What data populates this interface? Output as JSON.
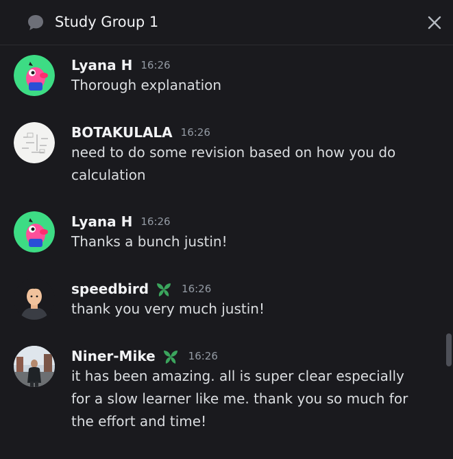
{
  "header": {
    "title": "Study Group 1",
    "thread_icon": "thread-bubble-icon",
    "close_icon": "close-icon"
  },
  "messages": [
    {
      "username": "Lyana H",
      "badge": "",
      "time": "16:26",
      "text": "Thorough explanation",
      "avatar": "pink-bird-avatar"
    },
    {
      "username": "BOTAKULALA",
      "badge": "",
      "time": "16:26",
      "text": "need to do some revision based on how you do calculation",
      "avatar": "sketch-avatar"
    },
    {
      "username": "Lyana H",
      "badge": "",
      "time": "16:26",
      "text": "Thanks a bunch justin!",
      "avatar": "pink-bird-avatar"
    },
    {
      "username": "speedbird",
      "badge": "leaf-badge-icon",
      "time": "16:26",
      "text": "thank you very much justin!",
      "avatar": "cartoon-man-avatar"
    },
    {
      "username": "Niner-Mike",
      "badge": "leaf-badge-icon",
      "time": "16:26",
      "text": "it has been amazing. all is super clear especially for a slow learner like me. thank you so much for the effort and time!",
      "avatar": "photo-avatar"
    }
  ],
  "colors": {
    "background": "#1a1a1e",
    "badge_green": "#3ba55d",
    "avatar_bird_bg": "#3ddc84",
    "avatar_bird_body": "#ff4f9a"
  }
}
